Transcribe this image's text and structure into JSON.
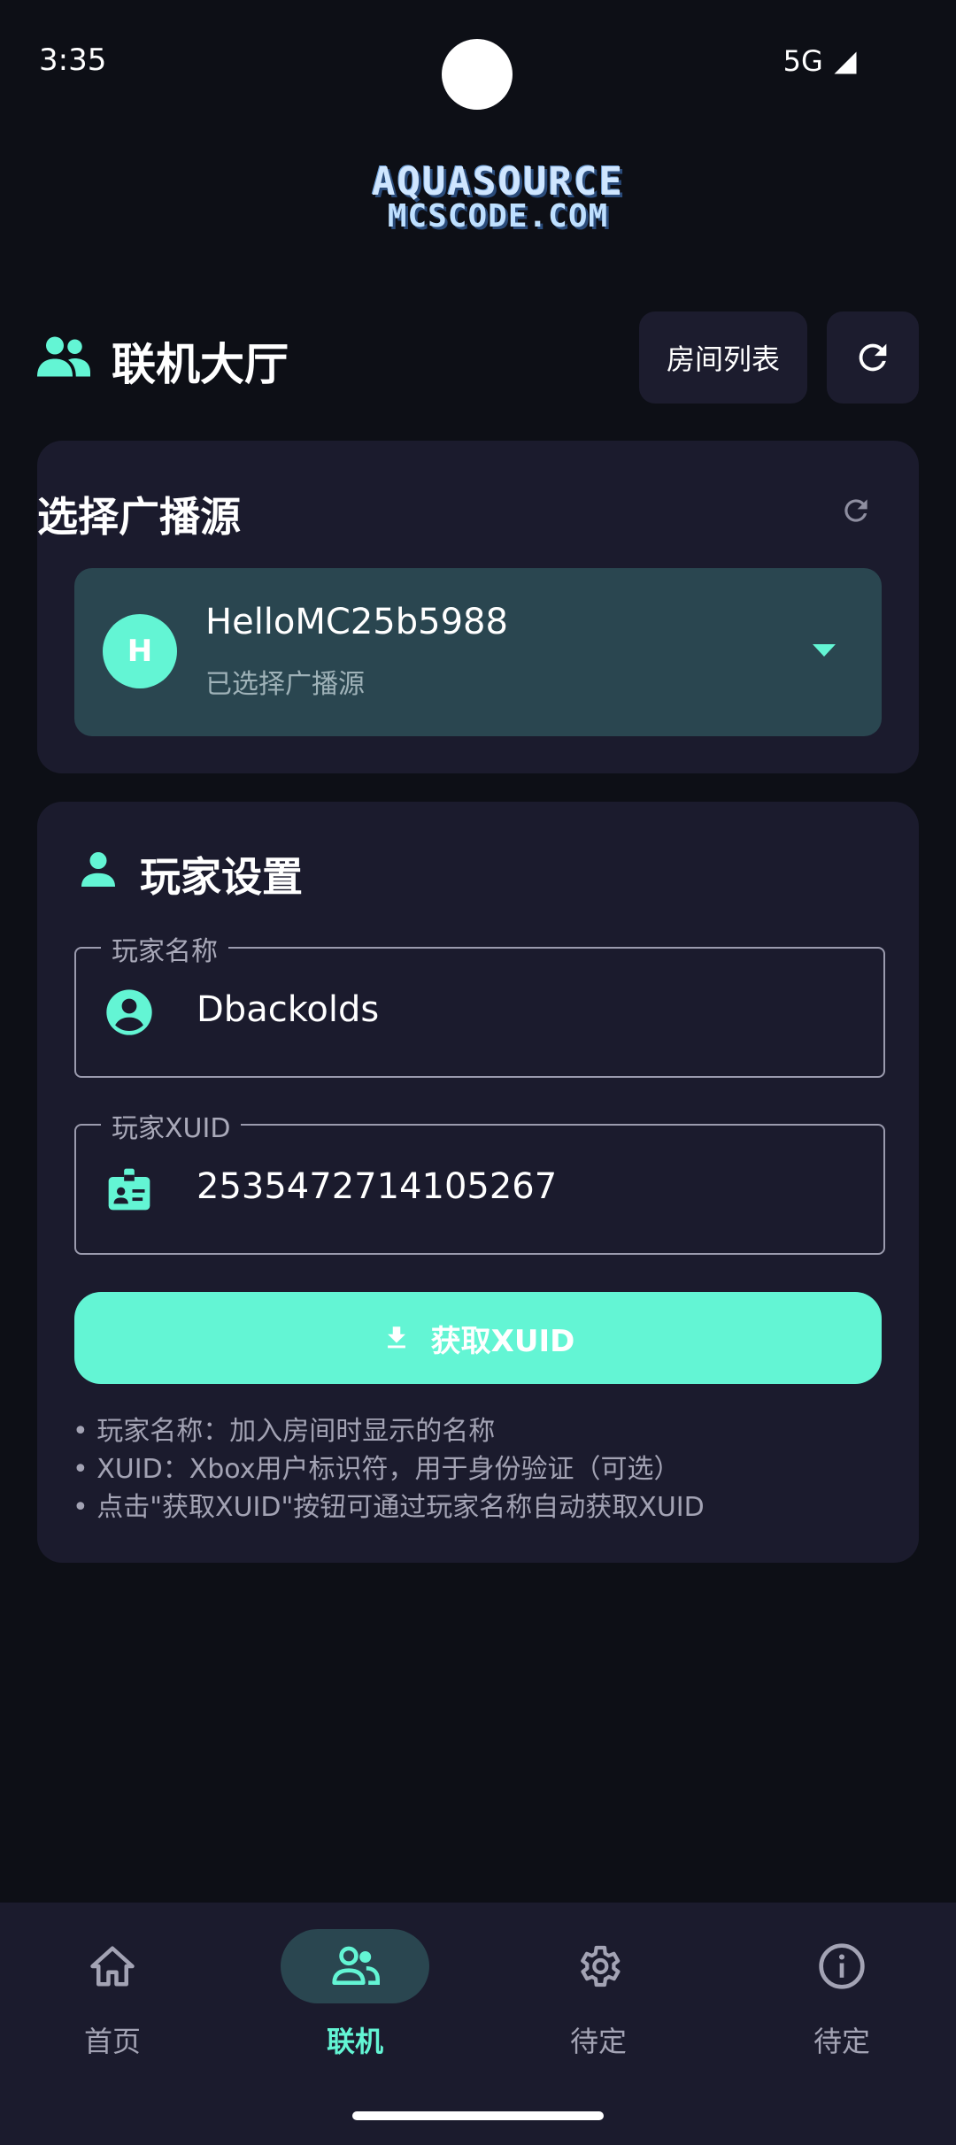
{
  "status_bar": {
    "time": "3:35",
    "network": "5G"
  },
  "logo": {
    "line1": "AQUASOURCE",
    "line2": "MCSCODE.COM"
  },
  "header": {
    "title": "联机大厅",
    "rooms_button": "房间列表"
  },
  "broadcast": {
    "title": "选择广播源",
    "avatar_letter": "H",
    "source_name": "HelloMC25b5988",
    "source_status": "已选择广播源"
  },
  "player": {
    "title": "玩家设置",
    "name_label": "玩家名称",
    "name_value": "Dbackolds",
    "xuid_label": "玩家XUID",
    "xuid_value": "2535472714105267",
    "fetch_button": "获取XUID",
    "hints": [
      "• 玩家名称：加入房间时显示的名称",
      "• XUID：Xbox用户标识符，用于身份验证（可选）",
      "• 点击\"获取XUID\"按钮可通过玩家名称自动获取XUID"
    ]
  },
  "nav": {
    "items": [
      {
        "label": "首页",
        "icon": "home-icon"
      },
      {
        "label": "联机",
        "icon": "group-icon"
      },
      {
        "label": "待定",
        "icon": "gear-icon"
      },
      {
        "label": "待定",
        "icon": "info-icon"
      }
    ]
  },
  "colors": {
    "accent": "#63f5d4",
    "background": "#0d0f16",
    "card": "#1b1b2d",
    "selected": "#2a4650"
  }
}
